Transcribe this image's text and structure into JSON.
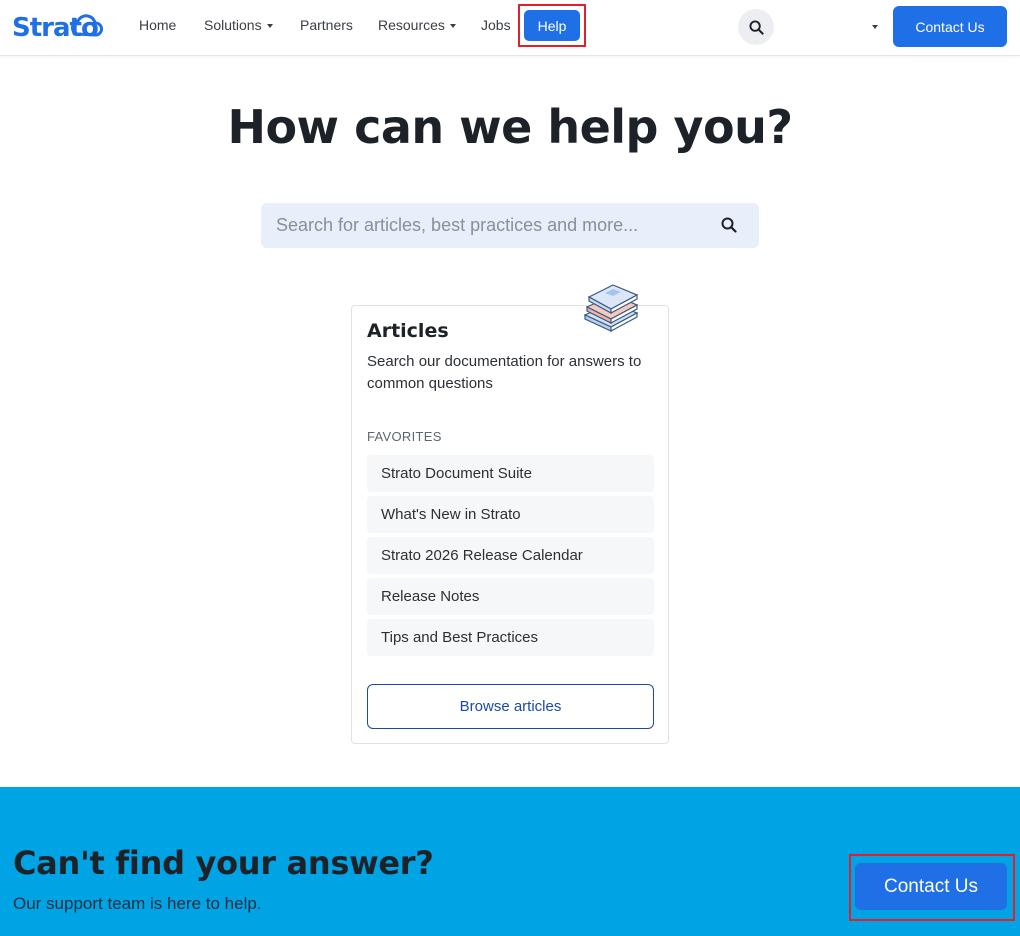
{
  "brand": {
    "logo_text": "Strato",
    "accent": "#1f6fe6",
    "band_color": "#00a3e4"
  },
  "nav": {
    "items": [
      {
        "label": "Home",
        "has_caret": false
      },
      {
        "label": "Solutions",
        "has_caret": true
      },
      {
        "label": "Partners",
        "has_caret": false
      },
      {
        "label": "Resources",
        "has_caret": true
      },
      {
        "label": "Jobs",
        "has_caret": false
      }
    ],
    "help_label": "Help",
    "search_icon": "search-icon",
    "language_icon": "caret-down-icon",
    "contact_label": "Contact Us"
  },
  "hero": {
    "title": "How can we help you?",
    "search_placeholder": "Search for articles, best practices and more...",
    "search_icon": "search-icon"
  },
  "articles_card": {
    "illustration": "books-icon",
    "title": "Articles",
    "description": "Search our documentation for answers to common questions",
    "favorites_label": "FAVORITES",
    "favorites": [
      "Strato Document Suite",
      "What's New in Strato",
      "Strato 2026 Release Calendar",
      "Release Notes",
      "Tips and Best Practices"
    ],
    "browse_label": "Browse articles"
  },
  "footer_band": {
    "title": "Can't find your answer?",
    "subtitle": "Our support team is here to help.",
    "contact_label": "Contact Us"
  }
}
